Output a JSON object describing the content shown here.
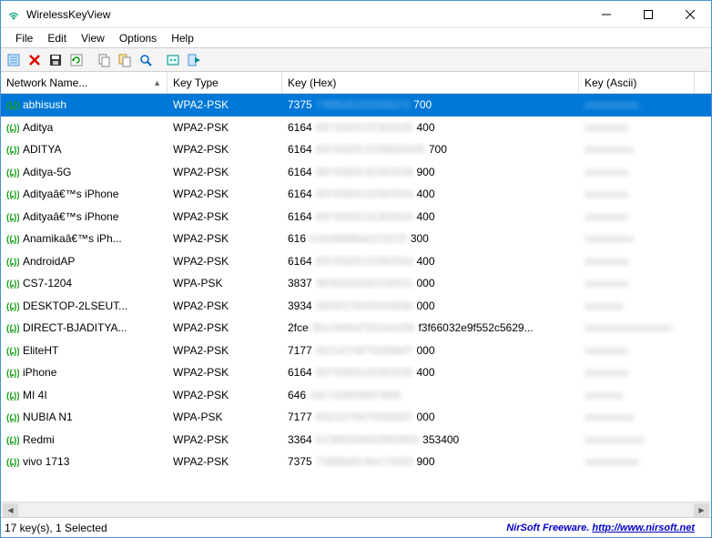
{
  "window": {
    "title": "WirelessKeyView"
  },
  "menubar": {
    "items": [
      "File",
      "Edit",
      "View",
      "Options",
      "Help"
    ]
  },
  "columns": {
    "name": "Network Name...",
    "type": "Key Type",
    "hex": "Key (Hex)",
    "ascii": "Key (Ascii)"
  },
  "rows": [
    {
      "name": "abhisush",
      "type": "WPA2-PSK",
      "hex_prefix": "7375",
      "hex_blur": "736f6d6162646a73",
      "hex_suffix": "700",
      "ascii": "xxxxxxxxxx",
      "selected": true
    },
    {
      "name": "Aditya",
      "type": "WPA2-PSK",
      "hex_prefix": "6164",
      "hex_blur": "6974583132363535",
      "hex_suffix": "400",
      "ascii": "xxxxxxxx"
    },
    {
      "name": "ADITYA",
      "type": "WPA2-PSK",
      "hex_prefix": "6164",
      "hex_blur": "697458313236583435",
      "hex_suffix": "700",
      "ascii": "xxxxxxxxx"
    },
    {
      "name": "Aditya-5G",
      "type": "WPA2-PSK",
      "hex_prefix": "6164",
      "hex_blur": "6974583132363539",
      "hex_suffix": "900",
      "ascii": "xxxxxxxx"
    },
    {
      "name": "Adityaâ€™s iPhone",
      "type": "WPA2-PSK",
      "hex_prefix": "6164",
      "hex_blur": "6974583132363534",
      "hex_suffix": "400",
      "ascii": "xxxxxxxx"
    },
    {
      "name": "Adityaâ€™s iPhone",
      "type": "WPA2-PSK",
      "hex_prefix": "6164",
      "hex_blur": "6974583132363534",
      "hex_suffix": "400",
      "ascii": "xxxxxxxx"
    },
    {
      "name": "Anamikaâ€™s iPh...",
      "type": "WPA2-PSK",
      "hex_prefix": "616",
      "hex_blur": "e1b49d98da313233",
      "hex_suffix": "300",
      "ascii": "xxxxxxxxx"
    },
    {
      "name": "AndroidAP",
      "type": "WPA2-PSK",
      "hex_prefix": "6164",
      "hex_blur": "6974583132363534",
      "hex_suffix": "400",
      "ascii": "xxxxxxxx"
    },
    {
      "name": "CS7-1204",
      "type": "WPA-PSK",
      "hex_prefix": "3837",
      "hex_blur": "3635343332316531",
      "hex_suffix": "000",
      "ascii": "xxxxxxxx"
    },
    {
      "name": "DESKTOP-2LSEUT...",
      "type": "WPA2-PSK",
      "hex_prefix": "3934",
      "hex_blur": "3839373635343938",
      "hex_suffix": "000",
      "ascii": "xxxxxxx"
    },
    {
      "name": "DIRECT-BJADITYA...",
      "type": "WPA2-PSK",
      "hex_prefix": "2fce",
      "hex_blur": "80c1848d7932ad156",
      "hex_suffix": "f3f66032e9f552c5629...",
      "ascii": "xxxxxxxxxxxxxxxx"
    },
    {
      "name": "EliteHT",
      "type": "WPA2-PSK",
      "hex_prefix": "7177",
      "hex_blur": "6521474875556b97",
      "hex_suffix": "000",
      "ascii": "xxxxxxxx"
    },
    {
      "name": "iPhone",
      "type": "WPA2-PSK",
      "hex_prefix": "6164",
      "hex_blur": "6974583132363535",
      "hex_suffix": "400",
      "ascii": "xxxxxxxx"
    },
    {
      "name": "MI 4I",
      "type": "WPA2-PSK",
      "hex_prefix": "646",
      "hex_blur": "16c7e5864697668",
      "hex_suffix": "",
      "ascii": "xxxxxxx"
    },
    {
      "name": "NUBIA N1",
      "type": "WPA-PSK",
      "hex_prefix": "7177",
      "hex_blur": "6521474875556b97",
      "hex_suffix": "000",
      "ascii": "xxxxxxxxx"
    },
    {
      "name": "Redmi",
      "type": "WPA2-PSK",
      "hex_prefix": "3364",
      "hex_blur": "61386330663983803",
      "hex_suffix": "353400",
      "ascii": "xxxxxxxxxxx"
    },
    {
      "name": "vivo 1713",
      "type": "WPA2-PSK",
      "hex_prefix": "7375",
      "hex_blur": "73686d614b173433",
      "hex_suffix": "900",
      "ascii": "xxxxxxxxxx"
    }
  ],
  "statusbar": {
    "left": "17 key(s), 1 Selected",
    "right_text": "NirSoft Freeware.  ",
    "right_url": "http://www.nirsoft.net"
  },
  "toolbar_icons": [
    "properties",
    "delete",
    "save",
    "refresh",
    "copy",
    "copy-all",
    "find",
    "options",
    "exit"
  ]
}
